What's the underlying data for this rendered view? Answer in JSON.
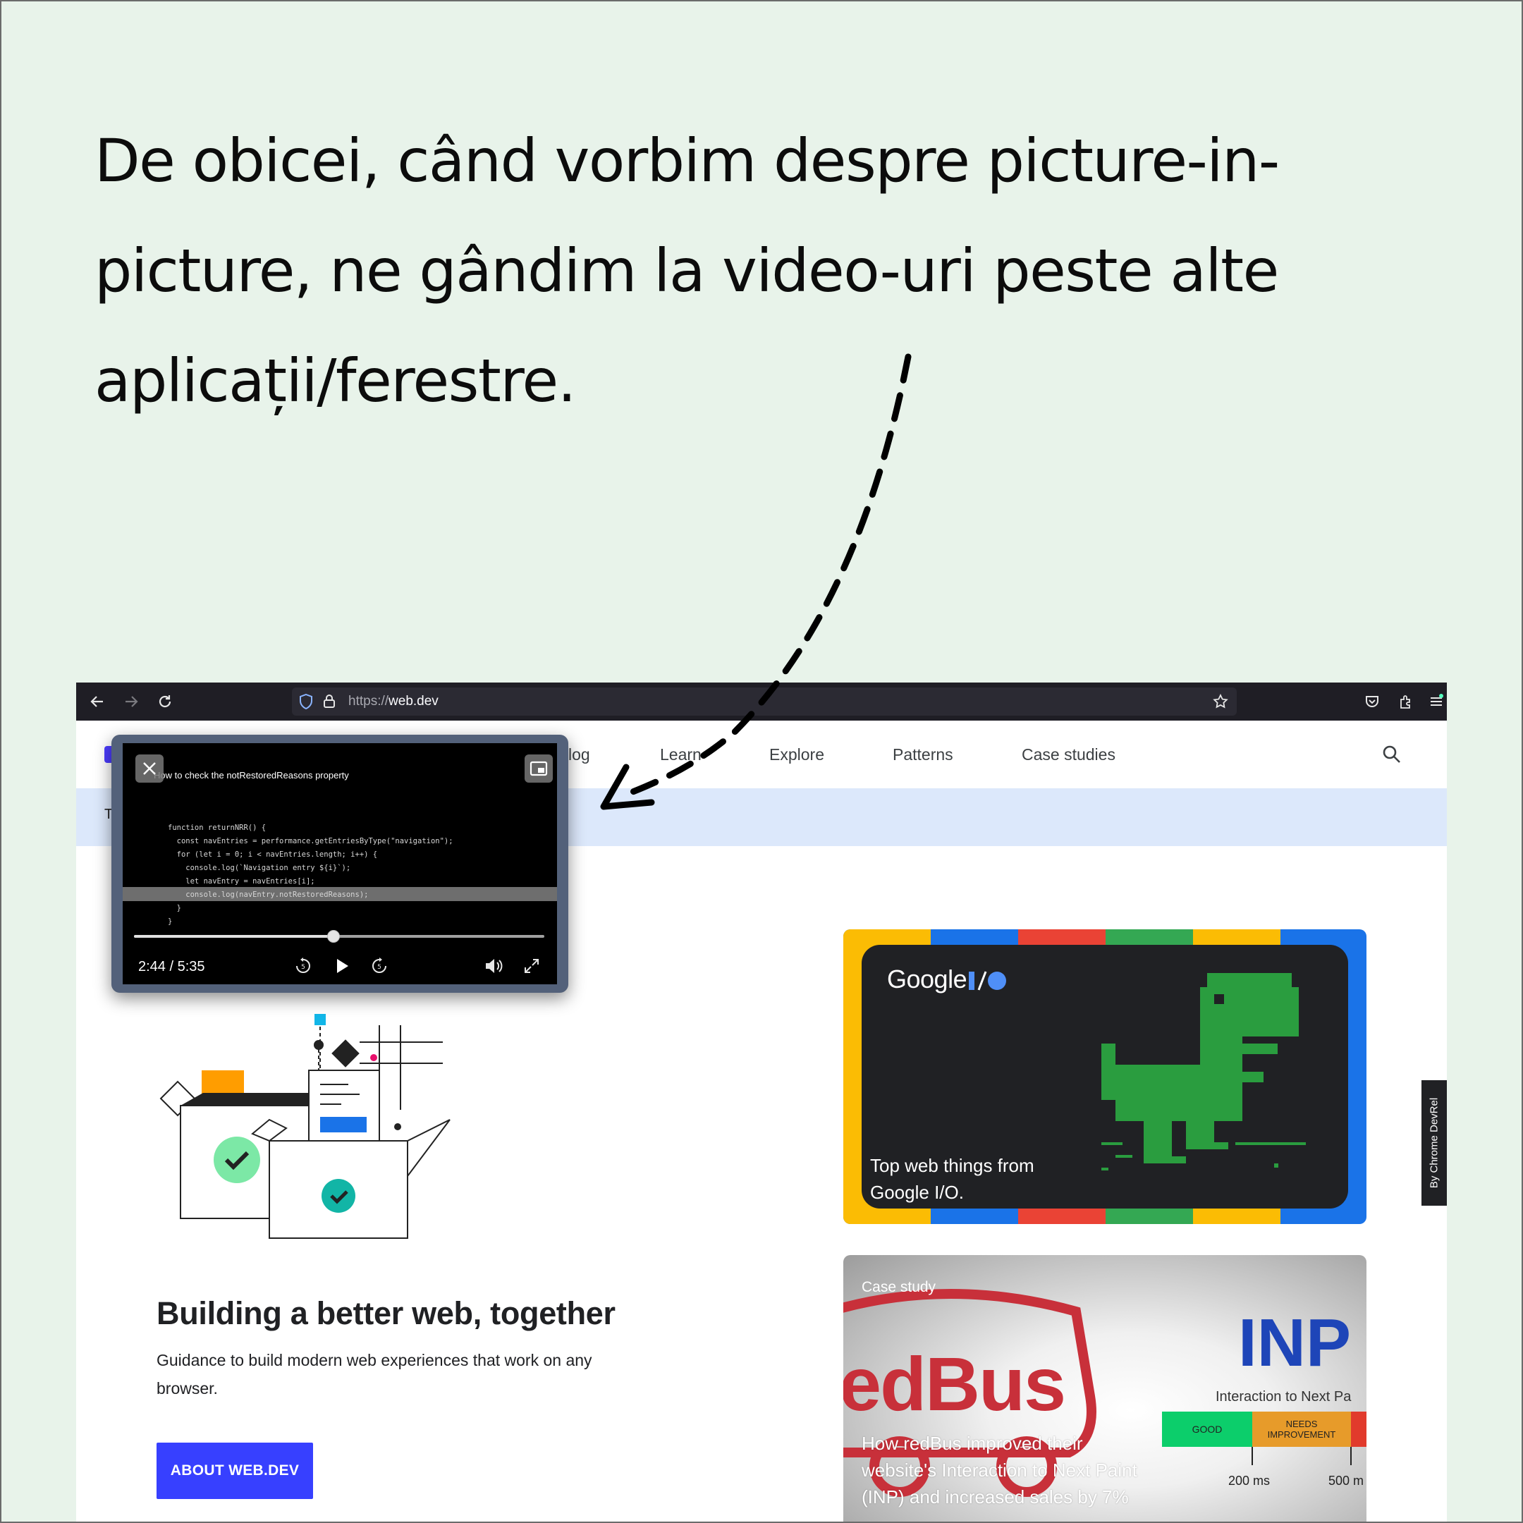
{
  "headline": {
    "line1": "De obicei, când vorbim despre picture-in-",
    "line2": "picture, ne gândim la video-uri peste alte",
    "line3": "aplicații/ferestre."
  },
  "browser": {
    "url_protocol": "https://",
    "url_domain": "web.dev",
    "nav": {
      "items": [
        "log",
        "Learn",
        "Explore",
        "Patterns",
        "Case studies"
      ]
    },
    "banner_letter": "T",
    "hero": {
      "title": "Building a better web, together",
      "description": "Guidance to build modern web experiences that work on any browser.",
      "button": "ABOUT WEB.DEV"
    },
    "io_card": {
      "logo": "Google",
      "caption": "Top web things from Google I/O."
    },
    "case_card": {
      "label": "Case study",
      "brand": "edBus",
      "big_text": "INP",
      "subtitle": "Interaction to Next Pa",
      "good": "GOOD",
      "needs": "NEEDS IMPROVEMENT",
      "tick1": "200 ms",
      "tick2": "500 m",
      "caption": "How redBus improved their website's Interaction to Next Paint (INP) and increased sales by 7%"
    },
    "devrel_tab": "By  Chrome DevRel"
  },
  "pip": {
    "title": "How to check the notRestoredReasons property",
    "time": "2:44 / 5:35",
    "progress": 0.487,
    "code": [
      "function returnNRR() {",
      "  const navEntries = performance.getEntriesByType(\"navigation\");",
      "  for (let i = 0; i < navEntries.length; i++) {",
      "    console.log(`Navigation entry ${i}`);",
      "    let navEntry = navEntries[i];",
      "    console.log(navEntry.notRestoredReasons);",
      "  }",
      "}"
    ]
  },
  "colors": {
    "background": "#e8f3ea",
    "toolbar": "#1f1e25",
    "accent_button": "#3740ff",
    "banner": "#dce8fb",
    "google_blue": "#1a73e8",
    "google_red": "#ea4335",
    "google_yellow": "#fbbc04",
    "google_green": "#34a853",
    "dino_green": "#2a9d3f"
  }
}
